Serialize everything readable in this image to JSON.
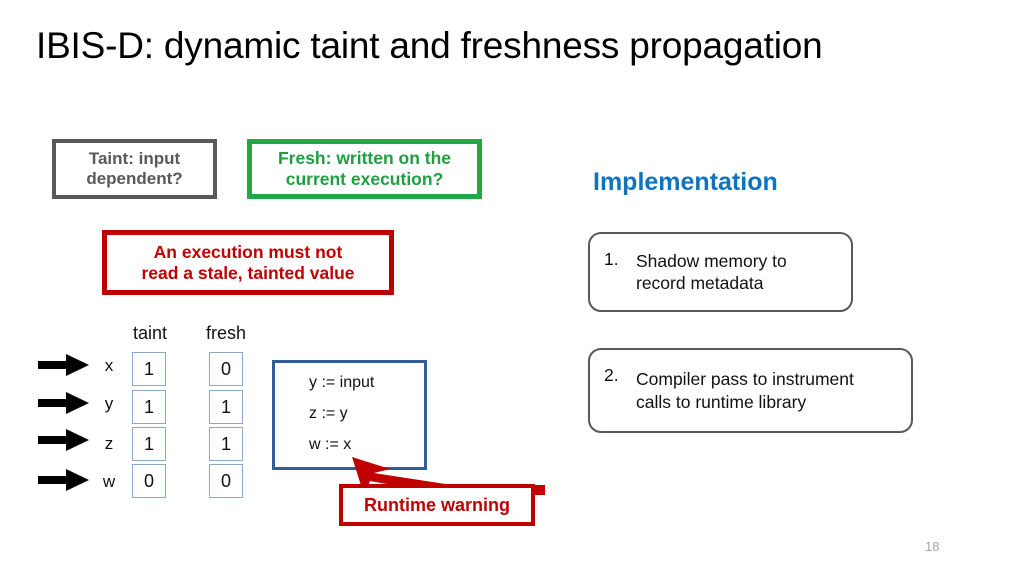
{
  "slide": {
    "title": "IBIS-D: dynamic taint and freshness propagation",
    "page_number": "18"
  },
  "definitions": {
    "taint": {
      "line1": "Taint: input",
      "line2": "dependent?",
      "border_color": "#595959",
      "text_color": "#595959"
    },
    "fresh": {
      "line1": "Fresh: written on the",
      "line2": "current execution?",
      "border_color": "#1fa845",
      "text_color": "#1f9e42"
    }
  },
  "invariant": {
    "line1": "An execution must not",
    "line2": "read a stale, tainted value",
    "color": "#c00000"
  },
  "metadata_table": {
    "columns": [
      "taint",
      "fresh"
    ],
    "rows": [
      {
        "variable": "x",
        "taint": "1",
        "fresh": "0"
      },
      {
        "variable": "y",
        "taint": "1",
        "fresh": "1"
      },
      {
        "variable": "z",
        "taint": "1",
        "fresh": "1"
      },
      {
        "variable": "w",
        "taint": "0",
        "fresh": "0"
      }
    ],
    "cell_border_color": "#8ea9c8",
    "arrow_icon": "right-arrow-icon"
  },
  "code": {
    "border_color": "#2e5f9a",
    "lines": [
      "y := input",
      "z := y",
      "w := x"
    ]
  },
  "runtime_warning": {
    "label": "Runtime warning",
    "color": "#c00000",
    "points_at": "w := x"
  },
  "implementation": {
    "heading": "Implementation",
    "heading_color": "#1073bd",
    "items": [
      {
        "number": "1.",
        "line1": "Shadow memory to",
        "line2": "record metadata"
      },
      {
        "number": "2.",
        "line1": "Compiler pass to instrument",
        "line2": "calls to runtime library"
      }
    ],
    "border_color": "#595959"
  }
}
